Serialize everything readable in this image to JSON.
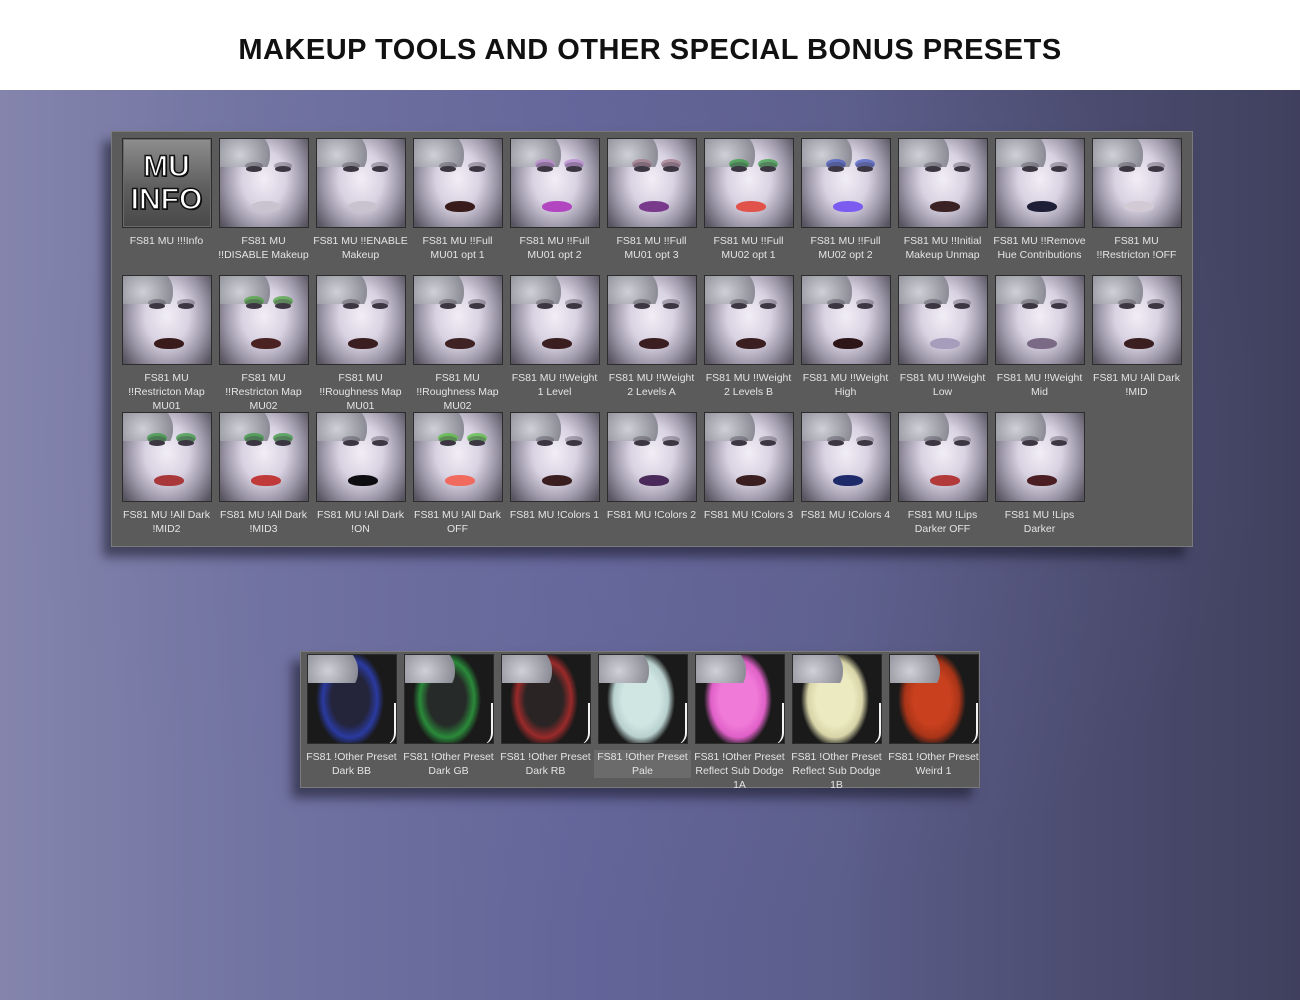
{
  "page": {
    "title": "MAKEUP TOOLS AND OTHER SPECIAL BONUS PRESETS"
  },
  "main_panel": {
    "info_tile": {
      "line1": "MU",
      "line2": "INFO"
    },
    "tiles": [
      {
        "label": "FS81 MU !!!Info",
        "lips": "",
        "eyes": ""
      },
      {
        "label": "FS81 MU\n!!DISABLE Makeup",
        "lips": "#c9c2cf",
        "eyes": ""
      },
      {
        "label": "FS81 MU !!ENABLE\nMakeup",
        "lips": "#c9c2cf",
        "eyes": ""
      },
      {
        "label": "FS81 MU !!Full\nMU01 opt 1",
        "lips": "#3a1b1c",
        "eyes": ""
      },
      {
        "label": "FS81 MU !!Full\nMU01 opt 2",
        "lips": "#b246c0",
        "eyes": "#b98ad0"
      },
      {
        "label": "FS81 MU !!Full\nMU01 opt 3",
        "lips": "#7a3a8c",
        "eyes": "#a27a8a"
      },
      {
        "label": "FS81 MU !!Full\nMU02 opt 1",
        "lips": "#e0524a",
        "eyes": "#3aa045"
      },
      {
        "label": "FS81 MU !!Full\nMU02 opt 2",
        "lips": "#7c5cf0",
        "eyes": "#4a5cc4"
      },
      {
        "label": "FS81 MU !!Initial\nMakeup Unmap",
        "lips": "#3a2224",
        "eyes": ""
      },
      {
        "label": "FS81 MU !!Remove\nHue Contributions",
        "lips": "#1e1e36",
        "eyes": ""
      },
      {
        "label": "FS81 MU\n!!Restricton !OFF",
        "lips": "#d2cbd6",
        "eyes": ""
      },
      {
        "label": "FS81 MU\n!!Restricton Map\nMU01",
        "lips": "#3a1b1c",
        "eyes": ""
      },
      {
        "label": "FS81 MU\n!!Restricton Map\nMU02",
        "lips": "#4a2222",
        "eyes": "#4fa640"
      },
      {
        "label": "FS81 MU\n!!Roughness Map\nMU01",
        "lips": "#3a1e20",
        "eyes": ""
      },
      {
        "label": "FS81 MU\n!!Roughness Map\nMU02",
        "lips": "#3e2224",
        "eyes": ""
      },
      {
        "label": "FS81 MU !!Weight\n1 Level",
        "lips": "#3a1e20",
        "eyes": ""
      },
      {
        "label": "FS81 MU !!Weight\n2 Levels A",
        "lips": "#3a1e20",
        "eyes": ""
      },
      {
        "label": "FS81 MU !!Weight\n2 Levels B",
        "lips": "#3a1e20",
        "eyes": ""
      },
      {
        "label": "FS81 MU !!Weight\nHigh",
        "lips": "#2e1618",
        "eyes": ""
      },
      {
        "label": "FS81 MU !!Weight\nLow",
        "lips": "#a69cbc",
        "eyes": ""
      },
      {
        "label": "FS81 MU !!Weight\nMid",
        "lips": "#7a6a86",
        "eyes": ""
      },
      {
        "label": "FS81 MU !All Dark\n!MID",
        "lips": "#3a1e20",
        "eyes": ""
      },
      {
        "label": "FS81 MU !All Dark\n!MID2",
        "lips": "#a8383a",
        "eyes": "#3a9a40"
      },
      {
        "label": "FS81 MU !All Dark\n!MID3",
        "lips": "#c03a3a",
        "eyes": "#3a9a40"
      },
      {
        "label": "FS81 MU !All Dark\n!ON",
        "lips": "#0e0e12",
        "eyes": ""
      },
      {
        "label": "FS81 MU !All Dark\nOFF",
        "lips": "#f06a5e",
        "eyes": "#58c040"
      },
      {
        "label": "FS81 MU !Colors 1",
        "lips": "#3a1e20",
        "eyes": ""
      },
      {
        "label": "FS81 MU !Colors 2",
        "lips": "#4a2a5a",
        "eyes": ""
      },
      {
        "label": "FS81 MU !Colors 3",
        "lips": "#3a1e20",
        "eyes": ""
      },
      {
        "label": "FS81 MU !Colors 4",
        "lips": "#1e2a6a",
        "eyes": ""
      },
      {
        "label": "FS81 MU !Lips\nDarker OFF",
        "lips": "#b23a3a",
        "eyes": ""
      },
      {
        "label": "FS81 MU !Lips\nDarker",
        "lips": "#4a1e22",
        "eyes": ""
      }
    ]
  },
  "bonus_panel": {
    "tiles": [
      {
        "label": "FS81 !Other Preset\nDark BB",
        "skin": "#24243a",
        "accent": "#2a3aa0"
      },
      {
        "label": "FS81 !Other Preset\nDark GB",
        "skin": "#262a28",
        "accent": "#2a8a3a"
      },
      {
        "label": "FS81 !Other Preset\nDark RB",
        "skin": "#2a2424",
        "accent": "#9a2a2a"
      },
      {
        "label": "FS81 !Other Preset\nPale",
        "skin": "#cfe6e2",
        "accent": "#b8d0ce",
        "selected": true
      },
      {
        "label": "FS81 !Other Preset\nReflect Sub Dodge\n1A",
        "skin": "#f07ad8",
        "accent": "#e060c8"
      },
      {
        "label": "FS81 !Other Preset\nReflect Sub Dodge\n1B",
        "skin": "#eceac0",
        "accent": "#d8d4a8"
      },
      {
        "label": "FS81 !Other Preset\nWeird 1",
        "skin": "#c8401e",
        "accent": "#a83418"
      }
    ]
  }
}
